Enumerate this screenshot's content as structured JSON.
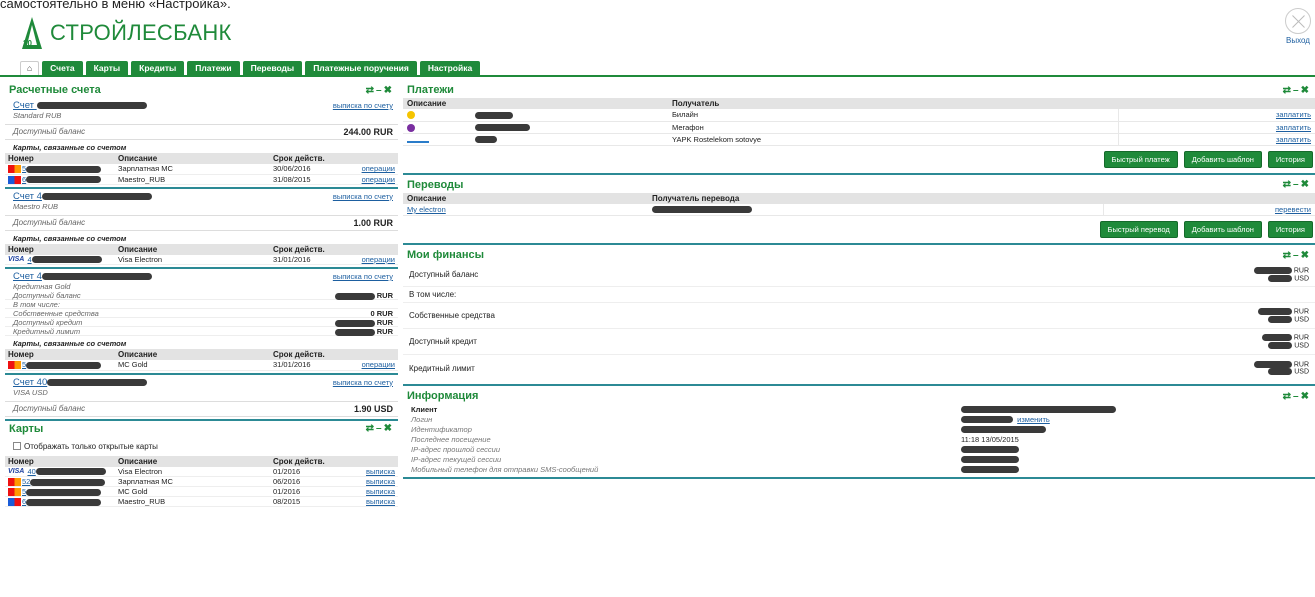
{
  "caption": "самостоятельно в меню «Настройка».",
  "brand": {
    "logo_number": "20",
    "name": "СТРОЙЛЕСБАНК",
    "color": "#1f8a3a"
  },
  "exit_label": "Выход",
  "nav": {
    "home_icon": "home-icon",
    "tabs": [
      "Счета",
      "Карты",
      "Кредиты",
      "Платежи",
      "Переводы",
      "Платежные поручения",
      "Настройка"
    ]
  },
  "accounts_panel": {
    "title": "Расчетные счета",
    "accounts": [
      {
        "name": "Счет",
        "sub": "Standard RUB",
        "statement": "выписка по счету",
        "balance_label": "Доступный баланс",
        "balance": "244.00 RUR",
        "cards_title": "Карты, связанные со счетом",
        "headers": [
          "Номер",
          "Описание",
          "Срок действ."
        ],
        "cards": [
          {
            "brand": "mc",
            "num": "5",
            "desc": "Зарплатная MC",
            "exp": "30/06/2016",
            "link": "операции"
          },
          {
            "brand": "maestro",
            "num": "6",
            "desc": "Maestro_RUB",
            "exp": "31/08/2015",
            "link": "операции"
          }
        ]
      },
      {
        "name": "Счет 4",
        "sub": "Maestro RUB",
        "statement": "выписка по счету",
        "balance_label": "Доступный баланс",
        "balance": "1.00 RUR",
        "cards_title": "Карты, связанные со счетом",
        "headers": [
          "Номер",
          "Описание",
          "Срок действ."
        ],
        "cards": [
          {
            "brand": "visa",
            "num": "4",
            "desc": "Visa Electron",
            "exp": "31/01/2016",
            "link": "операции"
          }
        ]
      },
      {
        "name": "Счет 4",
        "sub": "Кредитная Gold",
        "statement": "выписка по счету",
        "details": [
          {
            "label": "Доступный баланс",
            "value": "RUR"
          },
          {
            "label": "В том числе:",
            "value": ""
          },
          {
            "label": "Собственные средства",
            "value": "0 RUR"
          },
          {
            "label": "Доступный кредит",
            "value": "RUR"
          },
          {
            "label": "Кредитный лимит",
            "value": "RUR"
          }
        ],
        "cards_title": "Карты, связанные со счетом",
        "headers": [
          "Номер",
          "Описание",
          "Срок действ."
        ],
        "cards": [
          {
            "brand": "mc",
            "num": "5",
            "desc": "MC Gold",
            "exp": "31/01/2016",
            "link": "операции"
          }
        ]
      },
      {
        "name": "Счет 40",
        "sub": "VISA USD",
        "statement": "выписка по счету",
        "balance_label": "Доступный баланс",
        "balance": "1.90 USD"
      }
    ]
  },
  "cards_panel": {
    "title": "Карты",
    "checkbox_label": "Отображать только открытые карты",
    "headers": [
      "Номер",
      "Описание",
      "Срок действ."
    ],
    "rows": [
      {
        "brand": "visa",
        "num": "40",
        "desc": "Visa Electron",
        "exp": "01/2016",
        "link": "выписка"
      },
      {
        "brand": "mc",
        "num": "52",
        "desc": "Зарплатная MC",
        "exp": "06/2016",
        "link": "выписка"
      },
      {
        "brand": "mc",
        "num": "5",
        "desc": "MC Gold",
        "exp": "01/2016",
        "link": "выписка"
      },
      {
        "brand": "maestro",
        "num": "6",
        "desc": "Maestro_RUB",
        "exp": "08/2015",
        "link": "выписка"
      }
    ]
  },
  "payments_panel": {
    "title": "Платежи",
    "headers": [
      "Описание",
      "Получатель"
    ],
    "rows": [
      {
        "recipient": "Билайн",
        "action": "заплатить"
      },
      {
        "recipient": "Мегафон",
        "action": "заплатить"
      },
      {
        "recipient": "YAPK Rostelekom sotovye",
        "action": "заплатить"
      }
    ],
    "buttons": [
      "Быстрый платеж",
      "Добавить шаблон",
      "История"
    ]
  },
  "transfers_panel": {
    "title": "Переводы",
    "headers": [
      "Описание",
      "Получатель перевода"
    ],
    "rows": [
      {
        "desc": "My electron",
        "action": "перевести"
      }
    ],
    "buttons": [
      "Быстрый перевод",
      "Добавить шаблон",
      "История"
    ]
  },
  "finance_panel": {
    "title": "Мои финансы",
    "rows": [
      {
        "label": "Доступный баланс",
        "currencies": [
          "RUR",
          "USD"
        ]
      },
      {
        "label": "В том числе:",
        "currencies": []
      },
      {
        "label": "Собственные средства",
        "currencies": [
          "RUR",
          "USD"
        ]
      },
      {
        "label": "Доступный кредит",
        "currencies": [
          "RUR",
          "USD"
        ]
      },
      {
        "label": "Кредитный лимит",
        "currencies": [
          "RUR",
          "USD"
        ]
      }
    ]
  },
  "info_panel": {
    "title": "Информация",
    "rows": [
      {
        "label": "Клиент",
        "value": "",
        "bold": true
      },
      {
        "label": "Логин",
        "value": "",
        "link": "изменить"
      },
      {
        "label": "Идентификатор",
        "value": ""
      },
      {
        "label": "Последнее посещение",
        "value": "11:18 13/05/2015"
      },
      {
        "label": "IP-адрес прошлой сессии",
        "value": ""
      },
      {
        "label": "IP-адрес текущей сессии",
        "value": ""
      },
      {
        "label": "Мобильный телефон для отправки SMS-сообщений",
        "value": ""
      }
    ]
  }
}
